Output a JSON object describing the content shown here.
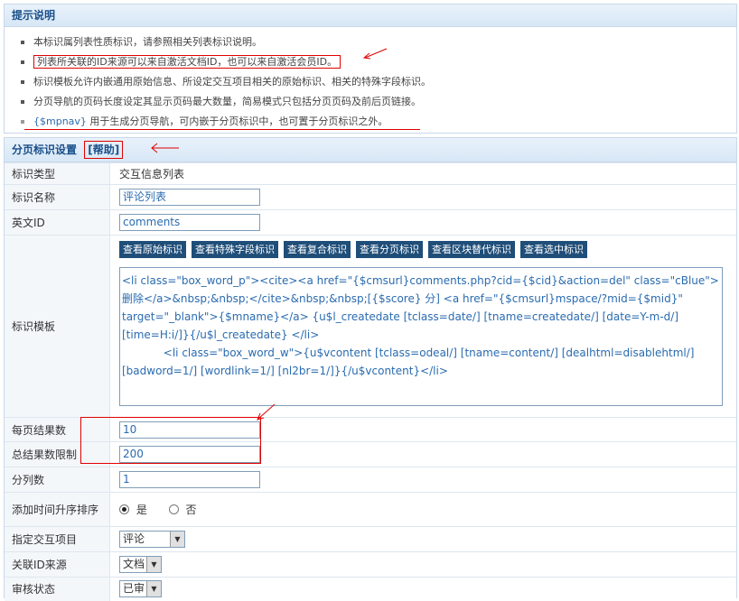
{
  "hints": {
    "title": "提示说明",
    "items": [
      "本标识属列表性质标识，请参照相关列表标识说明。",
      "列表所关联的ID来源可以来自激活文档ID，也可以来自激活会员ID。",
      "标识模板允许内嵌通用原始信息、所设定交互项目相关的原始标识、相关的特殊字段标识。",
      "分页导航的页码长度设定其显示页码最大数量，简易模式只包括分页页码及前后页链接。"
    ],
    "last_code": "{$mpnav}",
    "last_text": " 用于生成分页导航，可内嵌于分页标识中，也可置于分页标识之外。"
  },
  "settings": {
    "title": "分页标识设置",
    "help_label": "[帮助]",
    "type_label": "标识类型",
    "type_value": "交互信息列表",
    "name_label": "标识名称",
    "name_value": "评论列表",
    "enid_label": "英文ID",
    "enid_value": "comments",
    "template_label": "标识模板",
    "template_buttons": [
      "查看原始标识",
      "查看特殊字段标识",
      "查看复合标识",
      "查看分页标识",
      "查看区块替代标识",
      "查看选中标识"
    ],
    "template_value": "<li class=\"box_word_p\"><cite><a href=\"{$cmsurl}comments.php?cid={$cid}&action=del\" class=\"cBlue\">删除</a>&nbsp;&nbsp;</cite>&nbsp;&nbsp;[{$score} 分] <a href=\"{$cmsurl}mspace/?mid={$mid}\" target=\"_blank\">{$mname}</a> {u$l_createdate [tclass=date/] [tname=createdate/] [date=Y-m-d/] [time=H:i/]}{/u$l_createdate} </li>\n            <li class=\"box_word_w\">{u$vcontent [tclass=odeal/] [tname=content/] [dealhtml=disablehtml/] [badword=1/] [wordlink=1/] [nl2br=1/]}{/u$vcontent}</li>",
    "perpage_label": "每页结果数",
    "perpage_value": "10",
    "limit_label": "总结果数限制",
    "limit_value": "200",
    "cols_label": "分列数",
    "cols_value": "1",
    "asc_label": "添加时间升序排序",
    "asc_yes": "是",
    "asc_no": "否",
    "item_label": "指定交互项目",
    "item_value": "评论",
    "idsrc_label": "关联ID来源",
    "idsrc_value": "文档",
    "audit_label": "审核状态",
    "audit_value": "已审"
  }
}
